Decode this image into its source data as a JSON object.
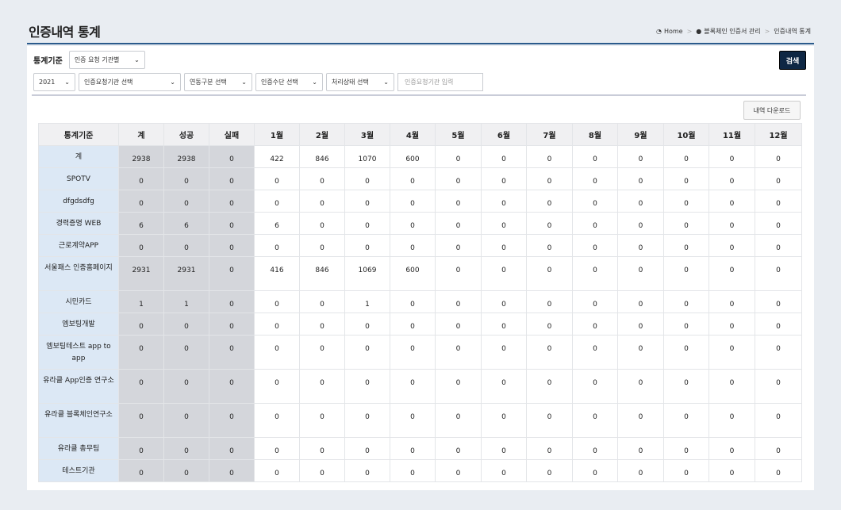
{
  "header": {
    "title": "인증내역 통계",
    "breadcrumb": [
      "Home",
      "블록체인 인증서 관리",
      "인증내역 통계"
    ]
  },
  "filters": {
    "label": "통계기준",
    "criteria": "인증 요청 기관별",
    "year": "2021",
    "org_select": "인증요청기관 선택",
    "link_type": "연동구분 선택",
    "auth_method": "인증수단 선택",
    "process_status": "처리상태 선택",
    "org_input_placeholder": "인증요청기관 입력",
    "search_label": "검색"
  },
  "download_label": "내역 다운로드",
  "table": {
    "headers": [
      "통계기준",
      "계",
      "성공",
      "실패",
      "1월",
      "2월",
      "3월",
      "4월",
      "5월",
      "6월",
      "7월",
      "8월",
      "9월",
      "10월",
      "11월",
      "12월"
    ],
    "rows": [
      {
        "name": "계",
        "values": [
          "2938",
          "2938",
          "0",
          "422",
          "846",
          "1070",
          "600",
          "0",
          "0",
          "0",
          "0",
          "0",
          "0",
          "0",
          "0"
        ],
        "tall": false
      },
      {
        "name": "SPOTV",
        "values": [
          "0",
          "0",
          "0",
          "0",
          "0",
          "0",
          "0",
          "0",
          "0",
          "0",
          "0",
          "0",
          "0",
          "0",
          "0"
        ],
        "tall": false
      },
      {
        "name": "dfgdsdfg",
        "values": [
          "0",
          "0",
          "0",
          "0",
          "0",
          "0",
          "0",
          "0",
          "0",
          "0",
          "0",
          "0",
          "0",
          "0",
          "0"
        ],
        "tall": false
      },
      {
        "name": "경력증명 WEB",
        "values": [
          "6",
          "6",
          "0",
          "6",
          "0",
          "0",
          "0",
          "0",
          "0",
          "0",
          "0",
          "0",
          "0",
          "0",
          "0"
        ],
        "tall": false
      },
      {
        "name": "근로계약APP",
        "values": [
          "0",
          "0",
          "0",
          "0",
          "0",
          "0",
          "0",
          "0",
          "0",
          "0",
          "0",
          "0",
          "0",
          "0",
          "0"
        ],
        "tall": false
      },
      {
        "name": "서울패스 인증홈페이지",
        "values": [
          "2931",
          "2931",
          "0",
          "416",
          "846",
          "1069",
          "600",
          "0",
          "0",
          "0",
          "0",
          "0",
          "0",
          "0",
          "0"
        ],
        "tall": true
      },
      {
        "name": "시민카드",
        "values": [
          "1",
          "1",
          "0",
          "0",
          "0",
          "1",
          "0",
          "0",
          "0",
          "0",
          "0",
          "0",
          "0",
          "0",
          "0"
        ],
        "tall": false
      },
      {
        "name": "엠보팅개발",
        "values": [
          "0",
          "0",
          "0",
          "0",
          "0",
          "0",
          "0",
          "0",
          "0",
          "0",
          "0",
          "0",
          "0",
          "0",
          "0"
        ],
        "tall": false
      },
      {
        "name": "엠보팅테스트 app to app",
        "values": [
          "0",
          "0",
          "0",
          "0",
          "0",
          "0",
          "0",
          "0",
          "0",
          "0",
          "0",
          "0",
          "0",
          "0",
          "0"
        ],
        "tall": true
      },
      {
        "name": "유라클 App인증 연구소",
        "values": [
          "0",
          "0",
          "0",
          "0",
          "0",
          "0",
          "0",
          "0",
          "0",
          "0",
          "0",
          "0",
          "0",
          "0",
          "0"
        ],
        "tall": true
      },
      {
        "name": "유라클 블록체인연구소",
        "values": [
          "0",
          "0",
          "0",
          "0",
          "0",
          "0",
          "0",
          "0",
          "0",
          "0",
          "0",
          "0",
          "0",
          "0",
          "0"
        ],
        "tall": true
      },
      {
        "name": "유라클 총무팀",
        "values": [
          "0",
          "0",
          "0",
          "0",
          "0",
          "0",
          "0",
          "0",
          "0",
          "0",
          "0",
          "0",
          "0",
          "0",
          "0"
        ],
        "tall": false
      },
      {
        "name": "테스트기관",
        "values": [
          "0",
          "0",
          "0",
          "0",
          "0",
          "0",
          "0",
          "0",
          "0",
          "0",
          "0",
          "0",
          "0",
          "0",
          "0"
        ],
        "tall": false
      }
    ]
  }
}
